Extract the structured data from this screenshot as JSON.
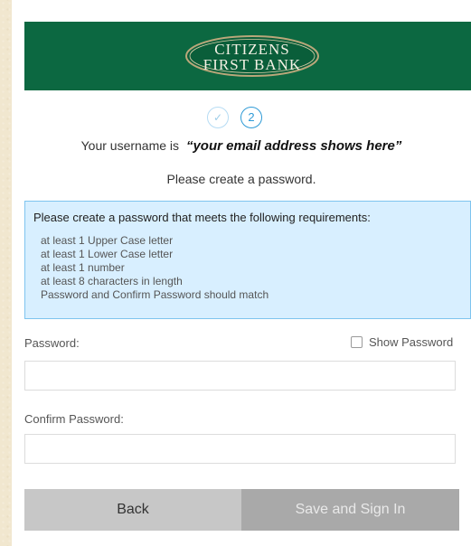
{
  "header": {
    "logo_line1": "CITIZENS",
    "logo_line2": "FIRST BANK",
    "background_color": "#0c6841"
  },
  "steps": [
    {
      "label": "✓",
      "state": "completed"
    },
    {
      "label": "2",
      "state": "current"
    }
  ],
  "username": {
    "prefix": "Your username is",
    "value": "“your email address shows here”"
  },
  "instruction": "Please create a password.",
  "requirements": {
    "title": "Please create a password that meets the following requirements:",
    "items": [
      "at least 1 Upper Case letter",
      "at least 1 Lower Case letter",
      "at least 1 number",
      "at least 8 characters in length",
      "Password and Confirm Password should match"
    ],
    "background_color": "#d8efff",
    "border_color": "#7ec4ef"
  },
  "form": {
    "password_label": "Password:",
    "show_password_label": "Show Password",
    "show_password_checked": false,
    "password_value": "",
    "confirm_label": "Confirm Password:",
    "confirm_value": ""
  },
  "buttons": {
    "back": "Back",
    "save": "Save and Sign In"
  }
}
